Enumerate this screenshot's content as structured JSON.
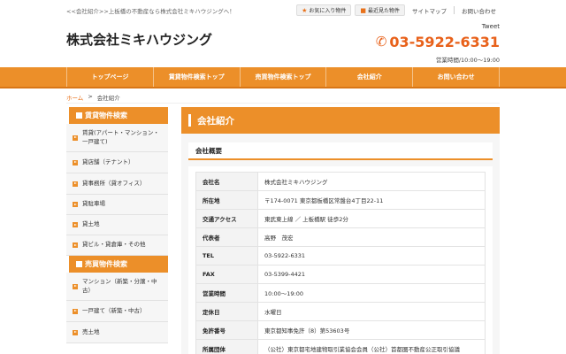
{
  "header": {
    "tagline": "<<会社紹介>>上板橋の不動産なら株式会社ミキハウジングへ！",
    "favorites_label": "お気に入り物件",
    "recent_label": "最近見た物件",
    "sitemap_label": "サイトマップ",
    "contact_label": "お問い合わせ",
    "logo": "株式会社ミキハウジング",
    "tweet_label": "Tweet",
    "phone": "03-5922-6331",
    "hours": "営業時間/10:00～19:00"
  },
  "nav": {
    "items": [
      {
        "label": "トップページ"
      },
      {
        "label": "賃貸物件検索トップ"
      },
      {
        "label": "売買物件検索トップ"
      },
      {
        "label": "会社紹介"
      },
      {
        "label": "お問い合わせ"
      }
    ]
  },
  "breadcrumb": {
    "home": "ホーム",
    "separator": ">",
    "current": "会社紹介"
  },
  "sidebar": {
    "rental_heading": "賃貸物件検索",
    "rental_items": [
      {
        "label": "賃貸(アパート・マンション・一戸建て)"
      },
      {
        "label": "貸店舗（テナント）"
      },
      {
        "label": "貸事務所（貸オフィス）"
      },
      {
        "label": "貸駐車場"
      },
      {
        "label": "貸土地"
      },
      {
        "label": "貸ビル・貸倉庫・その他"
      }
    ],
    "sale_heading": "売買物件検索",
    "sale_items": [
      {
        "label": "マンション（新築・分譲・中古）"
      },
      {
        "label": "一戸建て（新築・中古）"
      },
      {
        "label": "売土地"
      }
    ]
  },
  "main": {
    "page_title": "会社紹介",
    "section_title": "会社概要",
    "rows": [
      {
        "label": "会社名",
        "value": "株式会社ミキハウジング"
      },
      {
        "label": "所在地",
        "value": "〒174-0071 東京都板橋区常盤台4丁目22-11"
      },
      {
        "label": "交通アクセス",
        "value": "東武東上線 ／ 上板橋駅 徒歩2分"
      },
      {
        "label": "代表者",
        "value": "高野　茂宏"
      },
      {
        "label": "TEL",
        "value": "03-5922-6331"
      },
      {
        "label": "FAX",
        "value": "03-5399-4421"
      },
      {
        "label": "営業時間",
        "value": "10:00～19:00"
      },
      {
        "label": "定休日",
        "value": "水曜日"
      },
      {
        "label": "免許番号",
        "value": "東京都知事免許（8）第53603号"
      },
      {
        "label": "所属団体",
        "value": "（公社）東京都宅地建物取引業協会会員（公社）首都圏不動産公正取引協議"
      }
    ]
  },
  "colors": {
    "accent": "#ec8f29",
    "accent_dark": "#d97616",
    "phone": "#e8611a"
  }
}
